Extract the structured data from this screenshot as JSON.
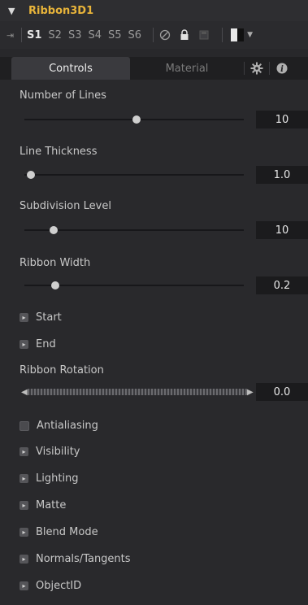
{
  "tool_name": "Ribbon3D1",
  "versions": [
    "S1",
    "S2",
    "S3",
    "S4",
    "S5",
    "S6"
  ],
  "active_version": "S1",
  "tabs": {
    "controls": "Controls",
    "material": "Material"
  },
  "icons": {
    "collapse": "chevron-down-icon",
    "pin": "pin-icon",
    "disable": "disable-icon",
    "lock": "lock-icon",
    "save": "save-icon",
    "color": "color-swatch-icon",
    "gear": "gear-icon",
    "info": "info-icon"
  },
  "colors": {
    "tool_name": "#e8b43a",
    "swatch_left": "#e8e8e8",
    "swatch_right": "#111111"
  },
  "controls": {
    "number_of_lines": {
      "label": "Number of Lines",
      "value": "10",
      "slider_fraction": 0.52
    },
    "line_thickness": {
      "label": "Line Thickness",
      "value": "1.0",
      "slider_fraction": 0.0
    },
    "subdivision_level": {
      "label": "Subdivision Level",
      "value": "10",
      "slider_fraction": 0.11
    },
    "ribbon_width": {
      "label": "Ribbon Width",
      "value": "0.2",
      "slider_fraction": 0.12
    },
    "start": "Start",
    "end": "End",
    "ribbon_rotation": {
      "label": "Ribbon Rotation",
      "value": "0.0"
    },
    "antialiasing": {
      "label": "Antialiasing",
      "checked": false
    },
    "visibility": "Visibility",
    "lighting": "Lighting",
    "matte": "Matte",
    "blend_mode": "Blend Mode",
    "normals_tangents": "Normals/Tangents",
    "object_id": "ObjectID"
  }
}
